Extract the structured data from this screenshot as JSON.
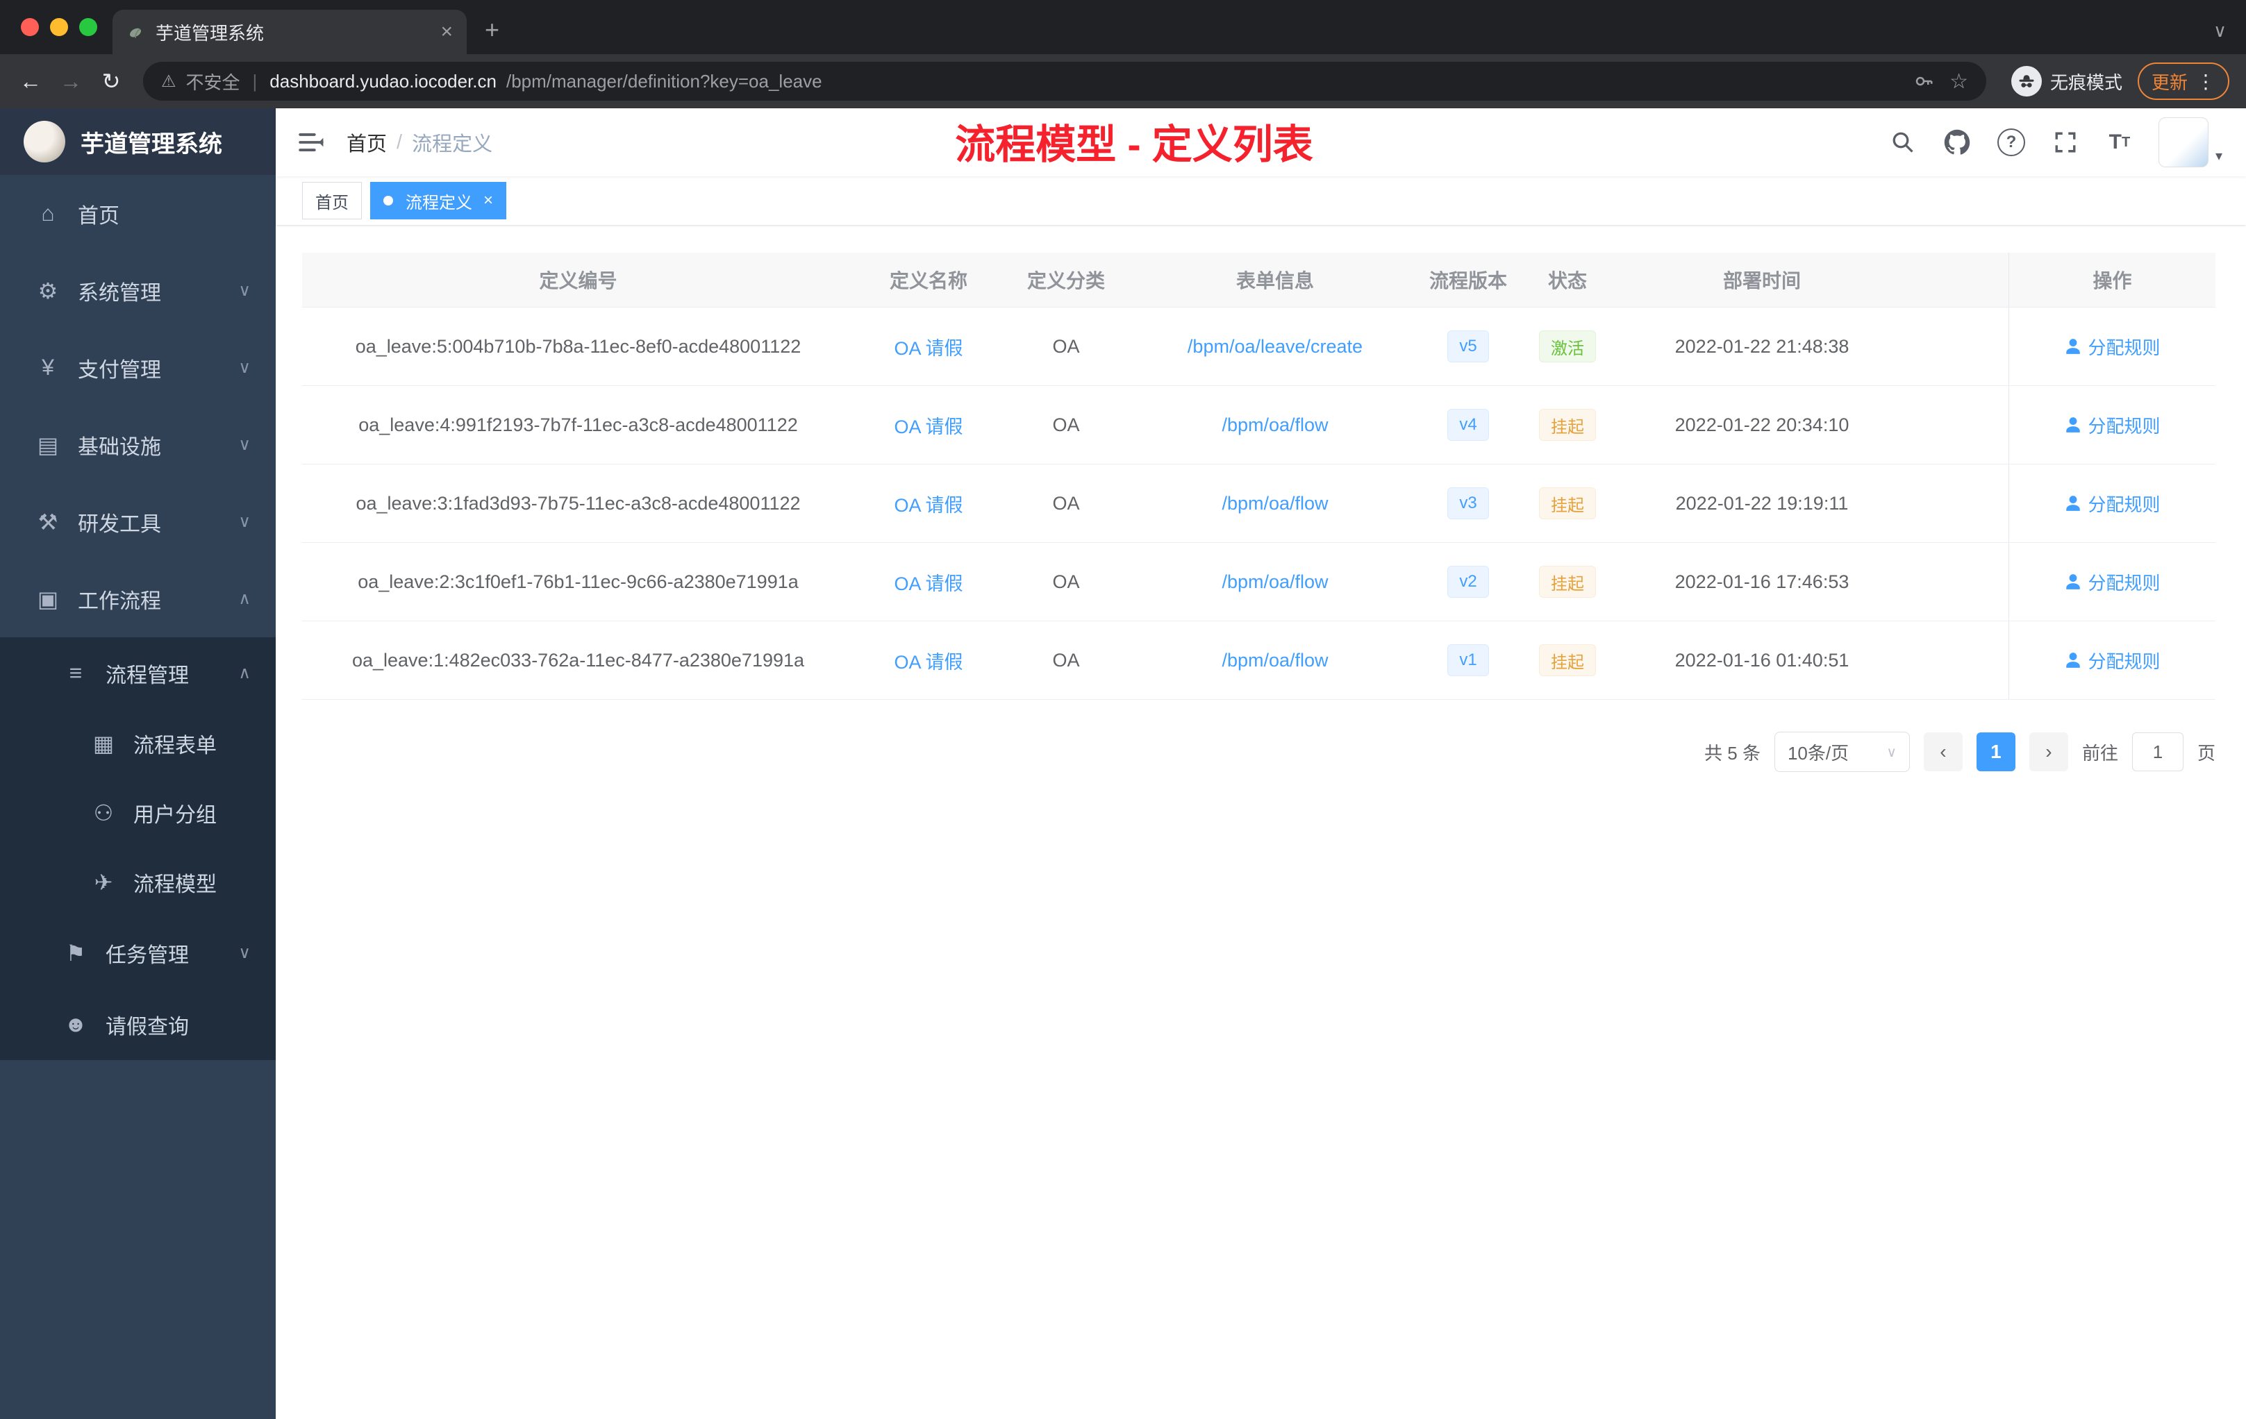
{
  "browser": {
    "tab_title": "芋道管理系统",
    "security_text": "不安全",
    "url_host": "dashboard.yudao.iocoder.cn",
    "url_path": "/bpm/manager/definition?key=oa_leave",
    "incognito_label": "无痕模式",
    "update_label": "更新"
  },
  "icons": {
    "home": "⌂",
    "system": "⚙",
    "payment": "¥",
    "infra": "▤",
    "devtools": "⚒",
    "workflow": "▣",
    "process_mgmt": "≡",
    "process_form": "▦",
    "user_group": "⚇",
    "process_model": "✈",
    "task_mgmt": "⚑",
    "leave_query": "☻",
    "chevron_down": "∨",
    "chevron_up": "∧",
    "back": "←",
    "forward": "→",
    "reload": "↻",
    "warning": "⚠",
    "url_divider": "|",
    "star": "☆",
    "plus": "+",
    "close": "×",
    "kebab": "⋮",
    "tab_caret": "∨",
    "question": "?",
    "font_big": "T",
    "font_small": "T",
    "avatar_caret": "▾",
    "prev": "‹",
    "next": "›",
    "select_caret": "∨"
  },
  "sidebar": {
    "logo_title": "芋道管理系统",
    "items": [
      {
        "label": "首页"
      },
      {
        "label": "系统管理"
      },
      {
        "label": "支付管理"
      },
      {
        "label": "基础设施"
      },
      {
        "label": "研发工具"
      },
      {
        "label": "工作流程"
      },
      {
        "label": "流程管理"
      },
      {
        "label": "流程表单"
      },
      {
        "label": "用户分组"
      },
      {
        "label": "流程模型"
      },
      {
        "label": "任务管理"
      },
      {
        "label": "请假查询"
      }
    ]
  },
  "header": {
    "breadcrumb_home": "首页",
    "breadcrumb_separator": "/",
    "breadcrumb_current": "流程定义",
    "page_title": "流程模型 - 定义列表"
  },
  "tags": {
    "items": [
      {
        "label": "首页"
      },
      {
        "label": "流程定义"
      }
    ]
  },
  "table": {
    "columns": [
      "定义编号",
      "定义名称",
      "定义分类",
      "表单信息",
      "流程版本",
      "状态",
      "部署时间",
      "操作"
    ],
    "rows": [
      {
        "id": "oa_leave:5:004b710b-7b8a-11ec-8ef0-acde48001122",
        "name": "OA 请假",
        "category": "OA",
        "form": "/bpm/oa/leave/create",
        "version": "v5",
        "status": "激活",
        "status_type": "success",
        "deploy_time": "2022-01-22 21:48:38",
        "action": "分配规则"
      },
      {
        "id": "oa_leave:4:991f2193-7b7f-11ec-a3c8-acde48001122",
        "name": "OA 请假",
        "category": "OA",
        "form": "/bpm/oa/flow",
        "version": "v4",
        "status": "挂起",
        "status_type": "warning",
        "deploy_time": "2022-01-22 20:34:10",
        "action": "分配规则"
      },
      {
        "id": "oa_leave:3:1fad3d93-7b75-11ec-a3c8-acde48001122",
        "name": "OA 请假",
        "category": "OA",
        "form": "/bpm/oa/flow",
        "version": "v3",
        "status": "挂起",
        "status_type": "warning",
        "deploy_time": "2022-01-22 19:19:11",
        "action": "分配规则"
      },
      {
        "id": "oa_leave:2:3c1f0ef1-76b1-11ec-9c66-a2380e71991a",
        "name": "OA 请假",
        "category": "OA",
        "form": "/bpm/oa/flow",
        "version": "v2",
        "status": "挂起",
        "status_type": "warning",
        "deploy_time": "2022-01-16 17:46:53",
        "action": "分配规则"
      },
      {
        "id": "oa_leave:1:482ec033-762a-11ec-8477-a2380e71991a",
        "name": "OA 请假",
        "category": "OA",
        "form": "/bpm/oa/flow",
        "version": "v1",
        "status": "挂起",
        "status_type": "warning",
        "deploy_time": "2022-01-16 01:40:51",
        "action": "分配规则"
      }
    ]
  },
  "pagination": {
    "total": "共 5 条",
    "page_size": "10条/页",
    "current_page": "1",
    "goto_label": "前往",
    "goto_value": "1",
    "page_unit": "页"
  },
  "colors": {
    "accent": "#409eff",
    "title_red": "#f5222d",
    "success": "#67c23a",
    "warning": "#e6a23c",
    "sidebar_bg": "#304156",
    "submenu_bg": "#1f2d3d"
  }
}
